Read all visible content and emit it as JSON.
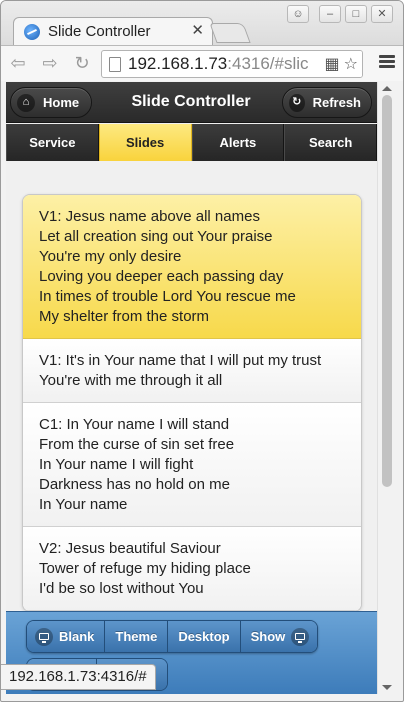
{
  "browser": {
    "tab_title": "Slide Controller",
    "tab_close": "✕",
    "url_host": "192.168.1.73",
    "url_rest": ":4316/#slic",
    "status_text": "192.168.1.73:4316/#"
  },
  "header": {
    "title": "Slide Controller",
    "home_label": "Home",
    "refresh_label": "Refresh"
  },
  "navbar": {
    "tabs": [
      {
        "label": "Service"
      },
      {
        "label": "Slides"
      },
      {
        "label": "Alerts"
      },
      {
        "label": "Search"
      }
    ],
    "active_tab": "Slides"
  },
  "slides": [
    {
      "lines": [
        "V1: Jesus name above all names",
        "Let all creation sing out Your praise",
        "You're my only desire",
        "Loving you deeper each passing day",
        "In times of trouble Lord You rescue me",
        "My shelter from the storm"
      ],
      "selected": true
    },
    {
      "lines": [
        "V1: It's in Your name that I will put my trust",
        "You're with me through it all"
      ],
      "selected": false
    },
    {
      "lines": [
        "C1: In Your name I will stand",
        "From the curse of sin set free",
        "In Your name I will fight",
        "Darkness has no hold on me",
        "In Your name"
      ],
      "selected": false
    },
    {
      "lines": [
        "V2: Jesus beautiful Saviour",
        "Tower of refuge my hiding place",
        "I'd be so lost without You"
      ],
      "selected": false
    }
  ],
  "footer": {
    "blank_label": "Blank",
    "theme_label": "Theme",
    "desktop_label": "Desktop",
    "show_label": "Show"
  },
  "colors": {
    "selected_slide": "#f7d94b",
    "active_tab": "#f9d33c",
    "header_bg": "#2a2a2a",
    "footer_bg": "#3d7cba"
  }
}
